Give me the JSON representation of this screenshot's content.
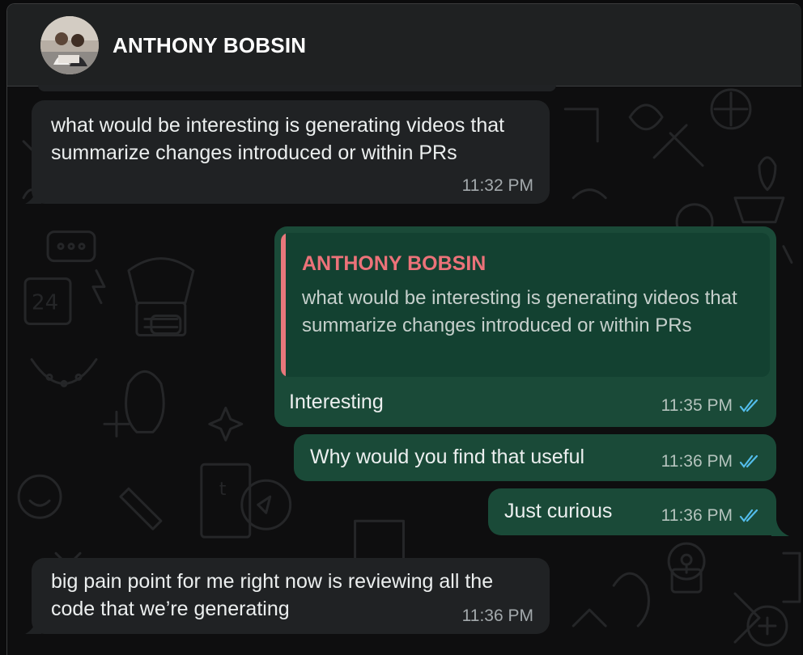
{
  "contact": {
    "name": "ANTHONY BOBSIN",
    "avatar_icon": "contact-photo"
  },
  "colors": {
    "incoming_bubble": "#202224",
    "outgoing_bubble": "#1a4a38",
    "quote_accent": "#e8777b",
    "read_receipt": "#53bdeb"
  },
  "messages": [
    {
      "direction": "in",
      "text": "what would be interesting is generating videos that summarize changes introduced or within PRs",
      "time": "11:32 PM"
    },
    {
      "direction": "out",
      "quote": {
        "author": "ANTHONY BOBSIN",
        "text": "what would be interesting is generating videos that summarize changes introduced or within PRs"
      },
      "text": "Interesting",
      "time": "11:35 PM",
      "status_icon": "double-check-read-icon"
    },
    {
      "direction": "out",
      "text": "Why would you find that useful",
      "time": "11:36 PM",
      "status_icon": "double-check-read-icon"
    },
    {
      "direction": "out",
      "text": "Just curious",
      "time": "11:36 PM",
      "status_icon": "double-check-read-icon"
    },
    {
      "direction": "in",
      "text": "big pain point for me right now is reviewing all the code that we’re generating",
      "time": "11:36 PM"
    }
  ]
}
